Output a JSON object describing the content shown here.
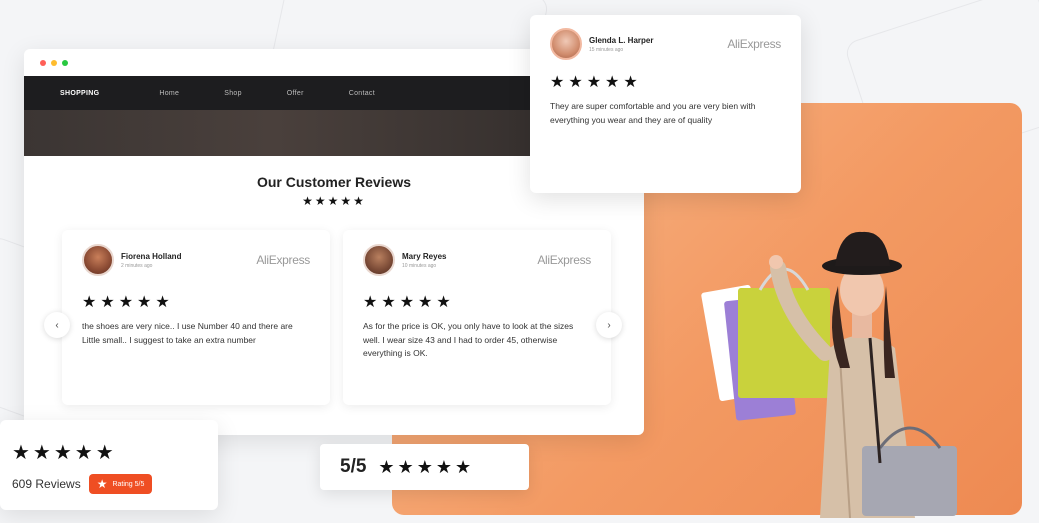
{
  "browser": {
    "nav": {
      "brand": "SHOPPING",
      "links": [
        "Home",
        "Shop",
        "Offer",
        "Contact"
      ]
    },
    "section_title": "Our Customer Reviews",
    "section_stars": "★★★★★"
  },
  "reviews": [
    {
      "name": "Fiorena Holland",
      "time": "2 minutes ago",
      "platform": "AliExpress",
      "stars": "★★★★★",
      "text": "the shoes are very nice.. I use Number 40 and there are Little small.. I suggest to take an extra number"
    },
    {
      "name": "Mary Reyes",
      "time": "10 minutes ago",
      "platform": "AliExpress",
      "stars": "★★★★★",
      "text": "As for the price is OK, you only have to look at the sizes well. I wear size 43 and I had to order 45, otherwise everything is OK."
    }
  ],
  "featured_review": {
    "name": "Glenda L. Harper",
    "time": "15 minutes ago",
    "platform": "AliExpress",
    "stars": "★★★★★",
    "text": "They are super comfortable and you are very bien with everything you wear and they are of quality"
  },
  "carousel": {
    "prev": "‹",
    "next": "›"
  },
  "rating_summary": {
    "stars": "★★★★★",
    "count_label": "609 Reviews",
    "pill_star": "★",
    "pill_label": "Rating",
    "pill_value": "5/5"
  },
  "score_badge": {
    "score": "5/5",
    "stars": "★★★★★"
  },
  "colors": {
    "accent_orange": "#f39a63",
    "pill_red": "#ef4e23",
    "nav_dark": "#1d1d1f"
  }
}
